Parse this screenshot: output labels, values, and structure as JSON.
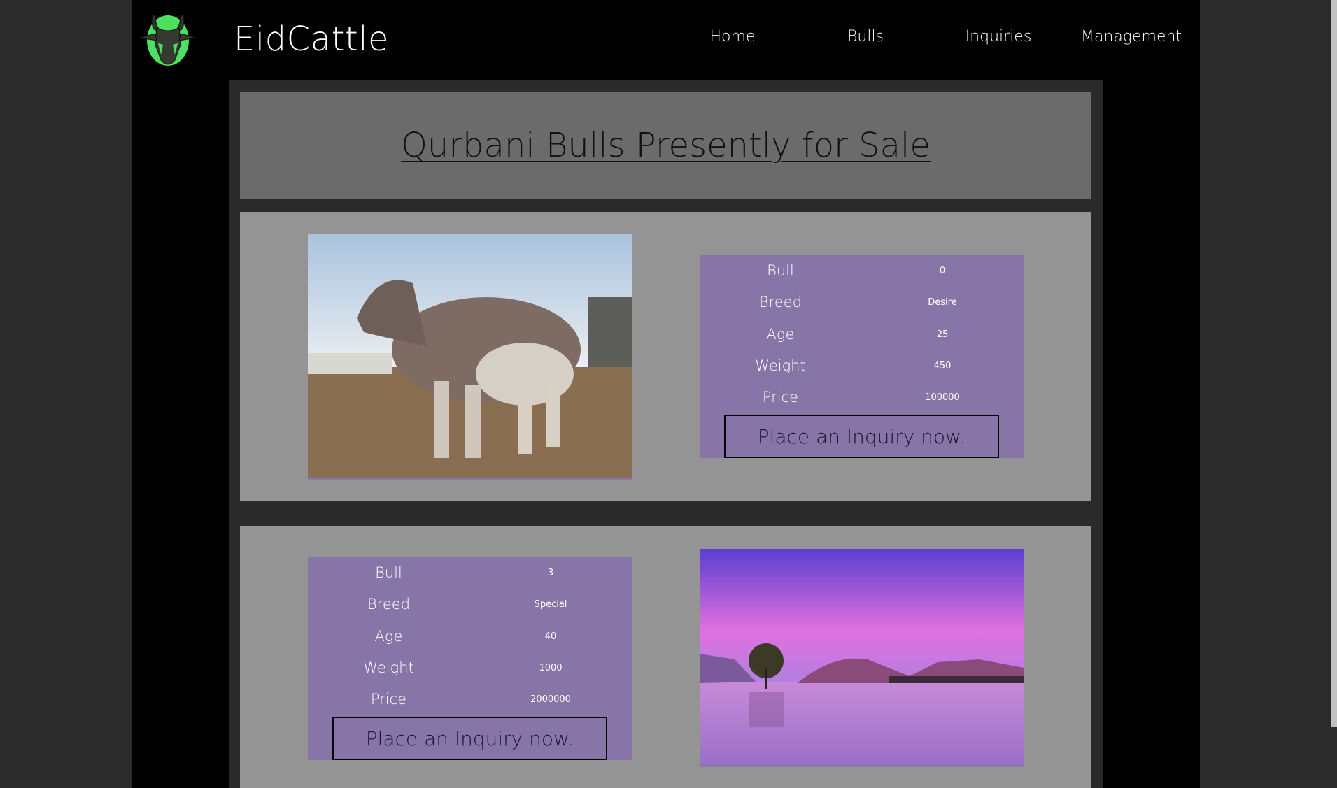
{
  "header": {
    "brand": "EidCattle",
    "nav": [
      "Home",
      "Bulls",
      "Inquiries",
      "Management"
    ]
  },
  "main": {
    "title": "Qurbani Bulls Presently for Sale"
  },
  "labels": [
    "Bull",
    "Breed",
    "Age",
    "Weight",
    "Price"
  ],
  "bulls": [
    {
      "values": [
        "0",
        "Desire",
        "25",
        "450",
        "100000"
      ],
      "button": "Place an Inquiry now.",
      "image": "bull-photo"
    },
    {
      "values": [
        "3",
        "Special",
        "40",
        "1000",
        "2000000"
      ],
      "button": "Place an Inquiry now.",
      "image": "purple-lake-landscape"
    }
  ],
  "colors": {
    "accent": "#8775a7",
    "logo_green": "#4ddf5f",
    "card": "#949494",
    "title_box": "#6b6b6b"
  }
}
